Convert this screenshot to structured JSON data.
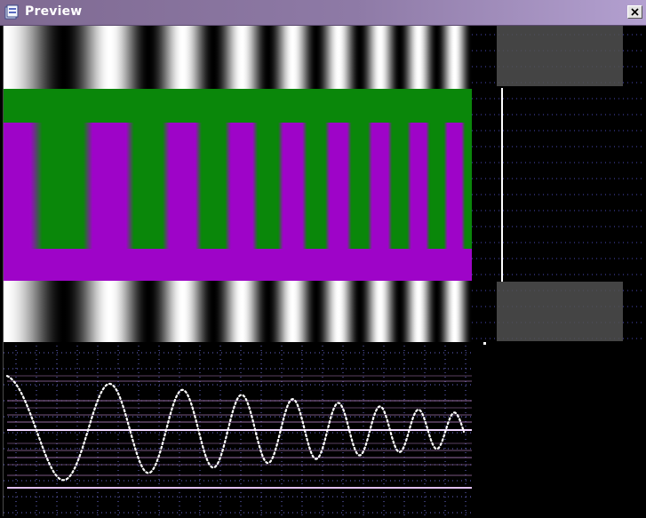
{
  "window": {
    "title": "Preview",
    "close_icon": "close-icon",
    "app_icon": "preview-app-icon"
  },
  "colors": {
    "window_bg": "#000000",
    "green_band": "#0a870a",
    "magenta_band": "#9e04c8",
    "scope_trace": "#ffffff",
    "scope_grid": "#6a6ad0",
    "scope_lines": "#c890d8",
    "marker_box": "#505050"
  },
  "panels": {
    "grating_panel": "sine-chirp-grating",
    "color_panel": "green-magenta-chirp",
    "waveform_panel": "chirp-waveform-scope",
    "side_panel": "dotted-grid-markers"
  }
}
